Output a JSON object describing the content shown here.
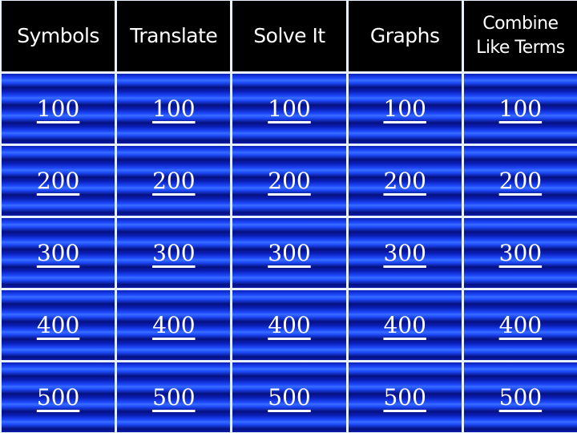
{
  "categories": [
    "Symbols",
    "Translate",
    "Solve It",
    "Graphs",
    "Combine Like Terms"
  ],
  "values": [
    "100",
    "200",
    "300",
    "400",
    "500"
  ],
  "colors": {
    "header_bg": "#000000",
    "cell_blue": "#1f4cff",
    "grid_lines": "#e8f0ff",
    "text": "#ffffff"
  }
}
